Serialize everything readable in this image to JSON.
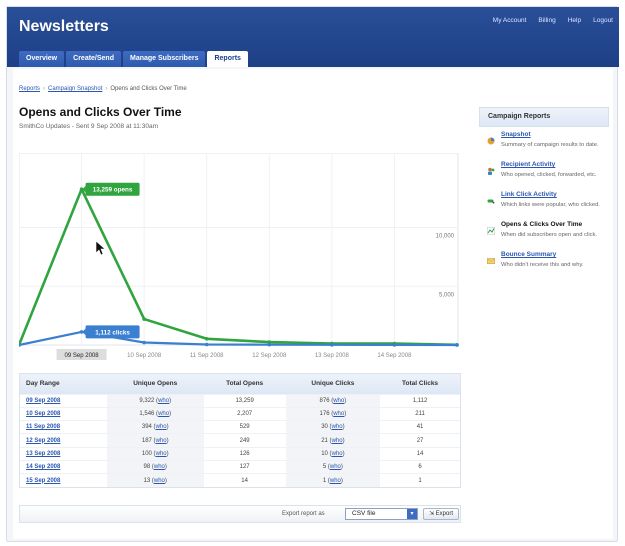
{
  "app": {
    "title": "Newsletters"
  },
  "top_links": [
    "My Account",
    "Billing",
    "Help",
    "Logout"
  ],
  "tabs": [
    {
      "label": "Overview",
      "active": false
    },
    {
      "label": "Create/Send",
      "active": false
    },
    {
      "label": "Manage Subscribers",
      "active": false
    },
    {
      "label": "Reports",
      "active": true
    }
  ],
  "breadcrumb": {
    "items": [
      "Reports",
      "Campaign Snapshot"
    ],
    "current": "Opens and Clicks Over Time",
    "separator": "›"
  },
  "page": {
    "title": "Opens and Clicks Over Time",
    "subtitle": "SmithCo Updates - Sent 9 Sep 2008 at 11:30am"
  },
  "chart_data": {
    "type": "line",
    "x": [
      "09 Sep 2008",
      "10 Sep 2008",
      "11 Sep 2008",
      "12 Sep 2008",
      "13 Sep 2008",
      "14 Sep 2008",
      "15 Sep 2008"
    ],
    "x_tick_labels": [
      "09 Sep 2008",
      "10 Sep 2008",
      "11 Sep 2008",
      "12 Sep 2008",
      "13 Sep 2008",
      "14 Sep 2008"
    ],
    "series": [
      {
        "key": "opens",
        "color": "#2fa43f",
        "values": [
          0,
          13259,
          2207,
          529,
          249,
          126,
          127,
          14
        ]
      },
      {
        "key": "clicks",
        "color": "#3a7fd0",
        "values": [
          0,
          1112,
          211,
          41,
          27,
          14,
          6,
          1
        ]
      }
    ],
    "y_ticks": [
      "5,000",
      "10,000"
    ],
    "ylim": [
      0,
      16000
    ],
    "grid": true,
    "annotations": [
      {
        "series": "opens",
        "text": "13,259 opens",
        "color": "#2fa43f"
      },
      {
        "series": "clicks",
        "text": "1,112 clicks",
        "color": "#3a7fd0"
      }
    ]
  },
  "table": {
    "headers": [
      "Day Range",
      "Unique Opens",
      "Total Opens",
      "Unique Clicks",
      "Total Clicks"
    ],
    "who_label": "who",
    "rows": [
      {
        "day": "09 Sep 2008",
        "unique_opens": "9,322",
        "total_opens": "13,259",
        "unique_clicks": "876",
        "total_clicks": "1,112"
      },
      {
        "day": "10 Sep 2008",
        "unique_opens": "1,546",
        "total_opens": "2,207",
        "unique_clicks": "176",
        "total_clicks": "211"
      },
      {
        "day": "11 Sep 2008",
        "unique_opens": "394",
        "total_opens": "529",
        "unique_clicks": "30",
        "total_clicks": "41"
      },
      {
        "day": "12 Sep 2008",
        "unique_opens": "187",
        "total_opens": "249",
        "unique_clicks": "21",
        "total_clicks": "27"
      },
      {
        "day": "13 Sep 2008",
        "unique_opens": "100",
        "total_opens": "126",
        "unique_clicks": "10",
        "total_clicks": "14"
      },
      {
        "day": "14 Sep 2008",
        "unique_opens": "98",
        "total_opens": "127",
        "unique_clicks": "5",
        "total_clicks": "6"
      },
      {
        "day": "15 Sep 2008",
        "unique_opens": "13",
        "total_opens": "14",
        "unique_clicks": "1",
        "total_clicks": "1"
      }
    ]
  },
  "export": {
    "label": "Export report as",
    "selected": "CSV file",
    "button": "Export"
  },
  "sidebar": {
    "title": "Campaign Reports",
    "items": [
      {
        "label": "Snapshot",
        "desc": "Summary of campaign results to date.",
        "icon": "pie-chart-icon",
        "current": false
      },
      {
        "label": "Recipient Activity",
        "desc": "Who opened, clicked, forwarded, etc.",
        "icon": "people-icon",
        "current": false
      },
      {
        "label": "Link Click Activity",
        "desc": "Which links were popular, who clicked.",
        "icon": "link-click-icon",
        "current": false
      },
      {
        "label": "Opens & Clicks Over Time",
        "desc": "When did subscribers open and click.",
        "icon": "line-chart-icon",
        "current": true
      },
      {
        "label": "Bounce Summary",
        "desc": "Who didn't receive this and why.",
        "icon": "envelope-icon",
        "current": false
      }
    ]
  }
}
